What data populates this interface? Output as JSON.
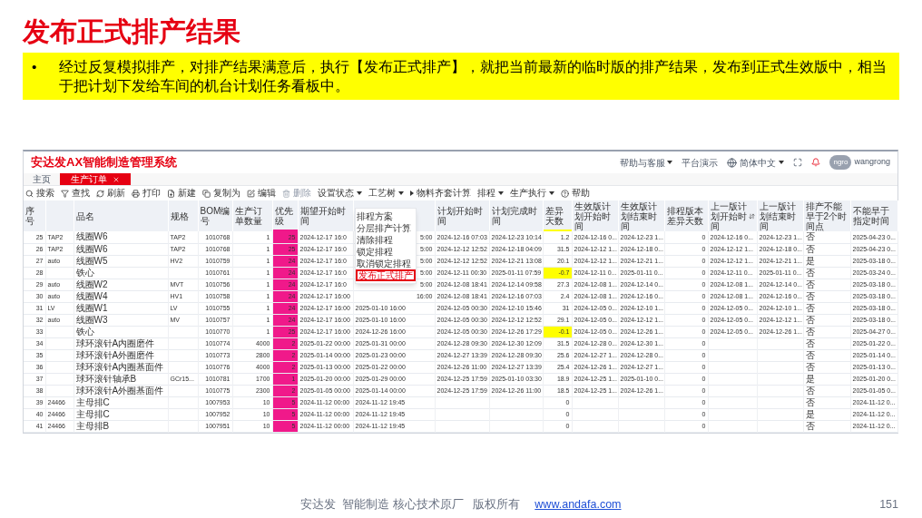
{
  "slide": {
    "title": "发布正式排产结果",
    "bullet": "•",
    "note": "经过反复模拟排产，对排产结果满意后，执行【发布正式排产】，就把当前最新的临时版的排产结果，发布到正式生效版中，相当于把计划下发给车间的机台计划任务看板中。",
    "footer": {
      "text": "安达发  智能制造 核心技术原厂   版权所有",
      "link": "www.andafa.com",
      "page": "151"
    }
  },
  "app": {
    "title": "安达发AX智能制造管理系统",
    "top_menu": [
      {
        "label": "帮助与客服",
        "dropdown": true
      },
      {
        "label": "平台演示",
        "dropdown": false
      }
    ],
    "language": {
      "label": "简体中文"
    },
    "user": {
      "avatar": "ngro",
      "name": "wangrong"
    },
    "tabs": [
      {
        "label": "主页",
        "selected": false,
        "closable": false
      },
      {
        "label": "生产订单",
        "selected": true,
        "closable": true
      }
    ],
    "toolbar": [
      {
        "kind": "search",
        "label": "搜索",
        "disabled": false
      },
      {
        "kind": "filter",
        "label": "查找",
        "disabled": false
      },
      {
        "kind": "refresh",
        "label": "刷新",
        "disabled": false
      },
      {
        "kind": "print",
        "label": "打印",
        "disabled": false
      },
      {
        "kind": "new",
        "label": "新建",
        "disabled": false
      },
      {
        "kind": "copy",
        "label": "复制为",
        "disabled": false
      },
      {
        "kind": "edit",
        "label": "编辑",
        "disabled": false
      },
      {
        "kind": "delete",
        "label": "删除",
        "disabled": true
      },
      {
        "kind": "dropdown",
        "label": "设置状态",
        "disabled": false
      },
      {
        "kind": "dropdown",
        "label": "工艺树",
        "disabled": false
      },
      {
        "kind": "expand",
        "label": "物料齐套计算",
        "disabled": false
      },
      {
        "kind": "dropdown",
        "label": "排程",
        "disabled": false
      },
      {
        "kind": "dropdown",
        "label": "生产执行",
        "disabled": false
      },
      {
        "kind": "help",
        "label": "帮助",
        "disabled": false
      }
    ],
    "menu": [
      {
        "label": "排程方案",
        "selected": false
      },
      {
        "label": "分层排产计算",
        "selected": false
      },
      {
        "label": "清除排程",
        "selected": false
      },
      {
        "label": "锁定排程",
        "selected": false
      },
      {
        "label": "取消锁定排程",
        "selected": false
      },
      {
        "label": "发布正式排产",
        "selected": true
      }
    ],
    "table": {
      "columns": [
        {
          "label": "序号",
          "sorted": false
        },
        {
          "sorted": false
        },
        {
          "label": "品名",
          "sorted": false
        },
        {
          "label": "规格",
          "sorted": false
        },
        {
          "label": "BOM编号",
          "sorted": false
        },
        {
          "label": "生产订单数量",
          "sorted": false
        },
        {
          "label": "优先级",
          "sorted": false,
          "color": "#f0198a"
        },
        {
          "label": "期望开始时间",
          "sorted": false
        },
        {
          "sorted": false
        },
        {
          "label": "计划开始时间",
          "sorted": false
        },
        {
          "label": "计划完成时间",
          "sorted": false
        },
        {
          "label": "差异天数",
          "sorted": false,
          "color": "#ffff00"
        },
        {
          "label": "生效版计划开始时间",
          "sorted": false
        },
        {
          "label": "生效版计划结束时间",
          "sorted": false
        },
        {
          "label": "排程版本差异天数",
          "sorted": false
        },
        {
          "label": "上一版计划开始时间",
          "sorted": true
        },
        {
          "label": "上一版计划结束时间",
          "sorted": false
        },
        {
          "label": "排产不能早于2个时间点",
          "sorted": false
        },
        {
          "label": "不能早于指定时间",
          "sorted": false
        }
      ],
      "rows": [
        {
          "alert": false,
          "cells": [
            "25",
            "TAP2",
            "线圈W6",
            "TAP2",
            "1010768",
            "1",
            "25",
            "2024-12-17 16:0",
            "5:00",
            "2024-12-16 07:03",
            "2024-12-23 10:14",
            "1.2",
            "2024-12-16 0...",
            "2024-12-23 1...",
            "0",
            "2024-12-16 0...",
            "2024-12-23 1...",
            "否",
            "2025-04-23 0..."
          ]
        },
        {
          "alert": false,
          "cells": [
            "26",
            "TAP2",
            "线圈W6",
            "TAP2",
            "1010768",
            "1",
            "25",
            "2024-12-17 16:0",
            "5:00",
            "2024-12-12 12:52",
            "2024-12-18 04:09",
            "31.5",
            "2024-12-12 1...",
            "2024-12-18 0...",
            "0",
            "2024-12-12 1...",
            "2024-12-18 0...",
            "否",
            "2025-04-23 0..."
          ]
        },
        {
          "alert": false,
          "cells": [
            "27",
            "auto",
            "线圈W5",
            "HV2",
            "1010759",
            "1",
            "24",
            "2024-12-17 16:0",
            "5:00",
            "2024-12-12 12:52",
            "2024-12-21 13:08",
            "20.1",
            "2024-12-12 1...",
            "2024-12-21 1...",
            "0",
            "2024-12-12 1...",
            "2024-12-21 1...",
            "是",
            "2025-03-18 0..."
          ]
        },
        {
          "alert": true,
          "cells": [
            "28",
            null,
            "铁心",
            null,
            "1010761",
            "1",
            "24",
            "2024-12-17 16:0",
            "5:00",
            "2024-12-11 00:30",
            "2025-01-11 07:59",
            "-0.7",
            "2024-12-11 0...",
            "2025-01-11 0...",
            "0",
            "2024-12-11 0...",
            "2025-01-11 0...",
            "否",
            "2025-03-24 0..."
          ]
        },
        {
          "alert": false,
          "cells": [
            "29",
            "auto",
            "线圈W2",
            "MVT",
            "1010756",
            "1",
            "24",
            "2024-12-17 16:0",
            "5:00",
            "2024-12-08 18:41",
            "2024-12-14 09:58",
            "27.3",
            "2024-12-08 1...",
            "2024-12-14 0...",
            "0",
            "2024-12-08 1...",
            "2024-12-14 0...",
            "否",
            "2025-03-18 0..."
          ]
        },
        {
          "alert": false,
          "cells": [
            "30",
            "auto",
            "线圈W4",
            "HV1",
            "1010758",
            "1",
            "24",
            "2024-12-17 16:00",
            "16:00",
            "2024-12-08 18:41",
            "2024-12-16 07:03",
            "2.4",
            "2024-12-08 1...",
            "2024-12-16 0...",
            "0",
            "2024-12-08 1...",
            "2024-12-16 0...",
            "否",
            "2025-03-18 0..."
          ]
        },
        {
          "alert": false,
          "cells": [
            "31",
            "LV",
            "线圈W1",
            "LV",
            "1010755",
            "1",
            "24",
            "2024-12-17 16:00",
            "2025-01-10 16:00",
            "2024-12-05 00:30",
            "2024-12-10 15:46",
            "31",
            "2024-12-05 0...",
            "2024-12-10 1...",
            "0",
            "2024-12-05 0...",
            "2024-12-10 1...",
            "否",
            "2025-03-18 0..."
          ]
        },
        {
          "alert": false,
          "cells": [
            "32",
            "auto",
            "线圈W3",
            "MV",
            "1010757",
            "1",
            "24",
            "2024-12-17 16:00",
            "2025-01-10 16:00",
            "2024-12-05 00:30",
            "2024-12-12 12:52",
            "29.1",
            "2024-12-05 0...",
            "2024-12-12 1...",
            "0",
            "2024-12-05 0...",
            "2024-12-12 1...",
            "否",
            "2025-03-18 0..."
          ]
        },
        {
          "alert": true,
          "cells": [
            "33",
            null,
            "铁心",
            null,
            "1010770",
            "1",
            "25",
            "2024-12-17 16:00",
            "2024-12-26 16:00",
            "2024-12-05 00:30",
            "2024-12-26 17:29",
            "-0.1",
            "2024-12-05 0...",
            "2024-12-26 1...",
            "0",
            "2024-12-05 0...",
            "2024-12-26 1...",
            "否",
            "2025-04-27 0..."
          ]
        },
        {
          "alert": false,
          "cells": [
            "34",
            null,
            "球环滚针A内圈磨件",
            null,
            "1010774",
            "4000",
            "2",
            "2025-01-22 00:00",
            "2025-01-31 00:00",
            "2024-12-28 09:30",
            "2024-12-30 12:09",
            "31.5",
            "2024-12-28 0...",
            "2024-12-30 1...",
            "0",
            null,
            null,
            "否",
            "2025-01-22 0..."
          ]
        },
        {
          "alert": false,
          "cells": [
            "35",
            null,
            "球环滚针A外圈磨件",
            null,
            "1010773",
            "2800",
            "2",
            "2025-01-14 00:00",
            "2025-01-23 00:00",
            "2024-12-27 13:39",
            "2024-12-28 09:30",
            "25.6",
            "2024-12-27 1...",
            "2024-12-28 0...",
            "0",
            null,
            null,
            "否",
            "2025-01-14 0..."
          ]
        },
        {
          "alert": false,
          "cells": [
            "36",
            null,
            "球环滚针A内圈基面件",
            null,
            "1010776",
            "4000",
            "2",
            "2025-01-13 00:00",
            "2025-01-22 00:00",
            "2024-12-26 11:00",
            "2024-12-27 13:39",
            "25.4",
            "2024-12-26 1...",
            "2024-12-27 1...",
            "0",
            null,
            null,
            "否",
            "2025-01-13 0..."
          ]
        },
        {
          "alert": false,
          "cells": [
            "37",
            null,
            "球环滚针轴承B",
            "GCr15...",
            "1010781",
            "1700",
            "1",
            "2025-01-20 00:00",
            "2025-01-29 00:00",
            "2024-12-25 17:59",
            "2025-01-10 03:30",
            "18.9",
            "2024-12-25 1...",
            "2025-01-10 0...",
            "0",
            null,
            null,
            "是",
            "2025-01-20 0..."
          ]
        },
        {
          "alert": false,
          "cells": [
            "38",
            null,
            "球环滚针A外圈基面件",
            null,
            "1010775",
            "2300",
            "2",
            "2025-01-05 00:00",
            "2025-01-14 00:00",
            "2024-12-25 17:59",
            "2024-12-26 11:00",
            "18.5",
            "2024-12-25 1...",
            "2024-12-26 1...",
            "0",
            null,
            null,
            "否",
            "2025-01-05 0..."
          ]
        },
        {
          "alert": false,
          "cells": [
            "39",
            "24466",
            "主母排C",
            null,
            "1007953",
            "10",
            "5",
            "2024-11-12 00:00",
            "2024-11-12 19:45",
            null,
            null,
            "0",
            null,
            null,
            "0",
            null,
            null,
            "否",
            "2024-11-12 0..."
          ]
        },
        {
          "alert": false,
          "cells": [
            "40",
            "24466",
            "主母排C",
            null,
            "1007952",
            "10",
            "5",
            "2024-11-12 00:00",
            "2024-11-12 19:45",
            null,
            null,
            "0",
            null,
            null,
            "0",
            null,
            null,
            "是",
            "2024-11-12 0..."
          ]
        },
        {
          "alert": false,
          "cells": [
            "41",
            "24466",
            "主母排B",
            null,
            "1007951",
            "10",
            "5",
            "2024-11-12 00:00",
            "2024-11-12 19:45",
            null,
            null,
            "0",
            null,
            null,
            "0",
            null,
            null,
            "否",
            "2024-11-12 0..."
          ]
        }
      ]
    }
  }
}
